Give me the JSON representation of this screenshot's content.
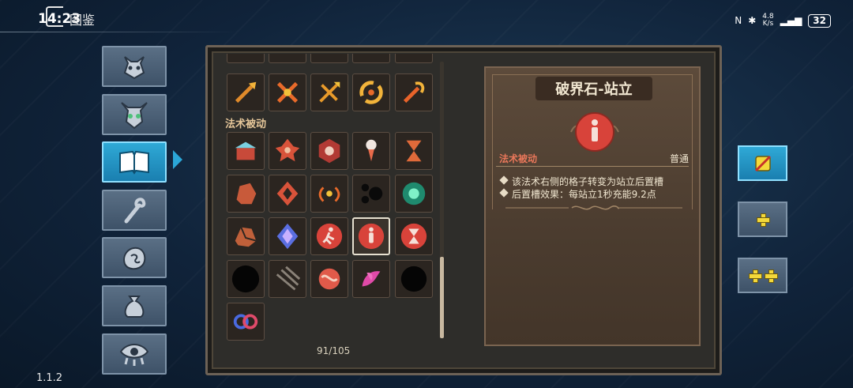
{
  "status_bar": {
    "time": "14:23",
    "net_speed_value": "4.8",
    "net_speed_unit": "K/s",
    "battery": "32"
  },
  "header": {
    "title": "图鉴"
  },
  "version": "1.1.2",
  "nav": {
    "items": [
      {
        "name": "demon-face-icon"
      },
      {
        "name": "horned-mask-icon"
      },
      {
        "name": "book-icon",
        "active": true
      },
      {
        "name": "staff-icon"
      },
      {
        "name": "stone-icon"
      },
      {
        "name": "bag-icon"
      },
      {
        "name": "eye-icon"
      }
    ]
  },
  "collection": {
    "section_label": "法术被动",
    "counter": "91/105",
    "selected": "standing-stone-icon"
  },
  "detail": {
    "title": "破界石-站立",
    "category": "法术被动",
    "rarity": "普通",
    "descriptions": [
      "该法术右侧的格子转变为站立后置槽",
      "后置槽效果：每站立1秒充能9.2点"
    ]
  },
  "side_buttons": [
    {
      "name": "slot-single-button",
      "active": true
    },
    {
      "name": "slot-plus-button",
      "plus_count": 1
    },
    {
      "name": "slot-double-plus-button",
      "plus_count": 2
    }
  ],
  "colors": {
    "accent_blue": "#2ba7d8",
    "rune_red": "#d8433a",
    "card_brown": "#4b3c2f",
    "tag_red": "#e9775a"
  }
}
